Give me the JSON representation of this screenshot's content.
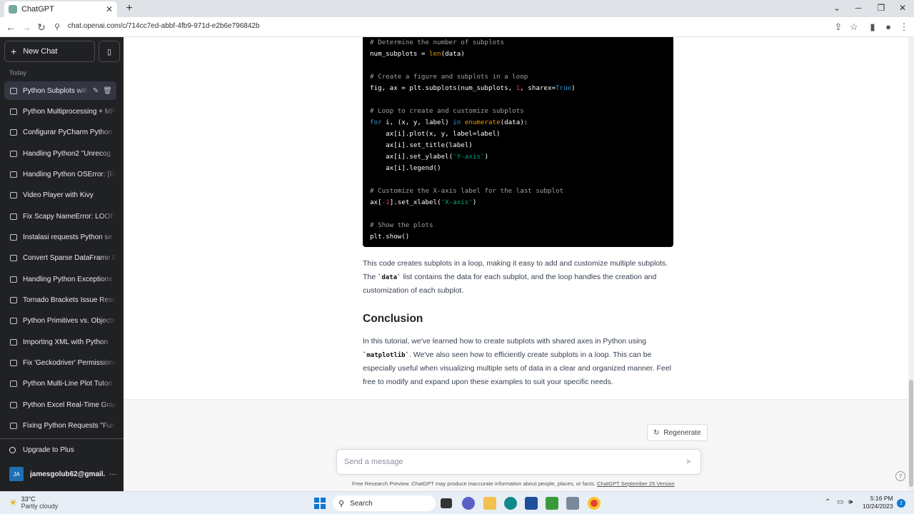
{
  "browser": {
    "tab_title": "ChatGPT",
    "tab_close": "✕",
    "new_tab": "+",
    "url": "chat.openai.com/c/714cc7ed-abbf-4fb9-971d-e2b6e796842b"
  },
  "sidebar": {
    "new_chat_label": "New Chat",
    "section_label": "Today",
    "items": [
      {
        "label": "Python Subplots with"
      },
      {
        "label": "Python Multiprocessing + MP"
      },
      {
        "label": "Configurar PyCharm Python"
      },
      {
        "label": "Handling Python2 \"Unrecog"
      },
      {
        "label": "Handling Python OSError: [Er"
      },
      {
        "label": "Video Player with Kivy"
      },
      {
        "label": "Fix Scapy NameError: LOOPB"
      },
      {
        "label": "Instalasi requests Python se"
      },
      {
        "label": "Convert Sparse DataFrame E"
      },
      {
        "label": "Handling Python Exceptions"
      },
      {
        "label": "Tornado Brackets Issue Reso"
      },
      {
        "label": "Python Primitives vs. Objects"
      },
      {
        "label": "Importing XML with Python"
      },
      {
        "label": "Fix 'Geckodriver' Permissions"
      },
      {
        "label": "Python Multi-Line Plot Tutori"
      },
      {
        "label": "Python Excel Real-Time Grap"
      },
      {
        "label": "Fixing Python Requests \"Fun"
      }
    ],
    "upgrade_label": "Upgrade to Plus",
    "account_initials": "JA",
    "account_email": "jamesgolub62@gmail.c",
    "more_label": "···"
  },
  "code": {
    "lines": [
      {
        "segments": [
          {
            "cls": "c-comment",
            "text": "# Determine the number of subplots"
          }
        ]
      },
      {
        "segments": [
          {
            "cls": "",
            "text": "num_subplots = "
          },
          {
            "cls": "c-func",
            "text": "len"
          },
          {
            "cls": "",
            "text": "(data)"
          }
        ]
      },
      {
        "segments": []
      },
      {
        "segments": [
          {
            "cls": "c-comment",
            "text": "# Create a figure and subplots in a loop"
          }
        ]
      },
      {
        "segments": [
          {
            "cls": "",
            "text": "fig, ax = plt.subplots(num_subplots, "
          },
          {
            "cls": "c-num",
            "text": "1"
          },
          {
            "cls": "",
            "text": ", sharex="
          },
          {
            "cls": "c-kw",
            "text": "True"
          },
          {
            "cls": "",
            "text": ")"
          }
        ]
      },
      {
        "segments": []
      },
      {
        "segments": [
          {
            "cls": "c-comment",
            "text": "# Loop to create and customize subplots"
          }
        ]
      },
      {
        "segments": [
          {
            "cls": "c-kw",
            "text": "for"
          },
          {
            "cls": "",
            "text": " i, (x, y, label) "
          },
          {
            "cls": "c-kw",
            "text": "in"
          },
          {
            "cls": "",
            "text": " "
          },
          {
            "cls": "c-func",
            "text": "enumerate"
          },
          {
            "cls": "",
            "text": "(data):"
          }
        ]
      },
      {
        "segments": [
          {
            "cls": "",
            "text": "    ax[i].plot(x, y, label=label)"
          }
        ]
      },
      {
        "segments": [
          {
            "cls": "",
            "text": "    ax[i].set_title(label)"
          }
        ]
      },
      {
        "segments": [
          {
            "cls": "",
            "text": "    ax[i].set_ylabel("
          },
          {
            "cls": "c-str",
            "text": "'Y-axis'"
          },
          {
            "cls": "",
            "text": ")"
          }
        ]
      },
      {
        "segments": [
          {
            "cls": "",
            "text": "    ax[i].legend()"
          }
        ]
      },
      {
        "segments": []
      },
      {
        "segments": [
          {
            "cls": "c-comment",
            "text": "# Customize the X-axis label for the last subplot"
          }
        ]
      },
      {
        "segments": [
          {
            "cls": "",
            "text": "ax["
          },
          {
            "cls": "c-num",
            "text": "-1"
          },
          {
            "cls": "",
            "text": "].set_xlabel("
          },
          {
            "cls": "c-str",
            "text": "'X-axis'"
          },
          {
            "cls": "",
            "text": ")"
          }
        ]
      },
      {
        "segments": []
      },
      {
        "segments": [
          {
            "cls": "c-comment",
            "text": "# Show the plots"
          }
        ]
      },
      {
        "segments": [
          {
            "cls": "",
            "text": "plt.show()"
          }
        ]
      }
    ]
  },
  "content": {
    "para1_a": "This code creates subplots in a loop, making it easy to add and customize multiple subplots. The ",
    "para1_code": "`data`",
    "para1_b": " list contains the data for each subplot, and the loop handles the creation and customization of each subplot.",
    "heading": "Conclusion",
    "para2_a": "In this tutorial, we've learned how to create subplots with shared axes in Python using ",
    "para2_code": "`matplotlib`",
    "para2_b": ". We've also seen how to efficiently create subplots in a loop. This can be especially useful when visualizing multiple sets of data in a clear and organized manner. Feel free to modify and expand upon these examples to suit your specific needs."
  },
  "composer": {
    "regenerate_label": "Regenerate",
    "placeholder": "Send a message",
    "disclaimer": "Free Research Preview. ChatGPT may produce inaccurate information about people, places, or facts. ",
    "version_link": "ChatGPT September 25 Version",
    "help": "?"
  },
  "taskbar": {
    "temperature": "33°C",
    "condition": "Partly cloudy",
    "search_label": "Search",
    "time": "5:16 PM",
    "date": "10/24/2023",
    "notification_count": "2"
  },
  "colors": {
    "sidebar_bg": "#202123",
    "accent": "#10a37f",
    "code_bg": "#000000"
  }
}
